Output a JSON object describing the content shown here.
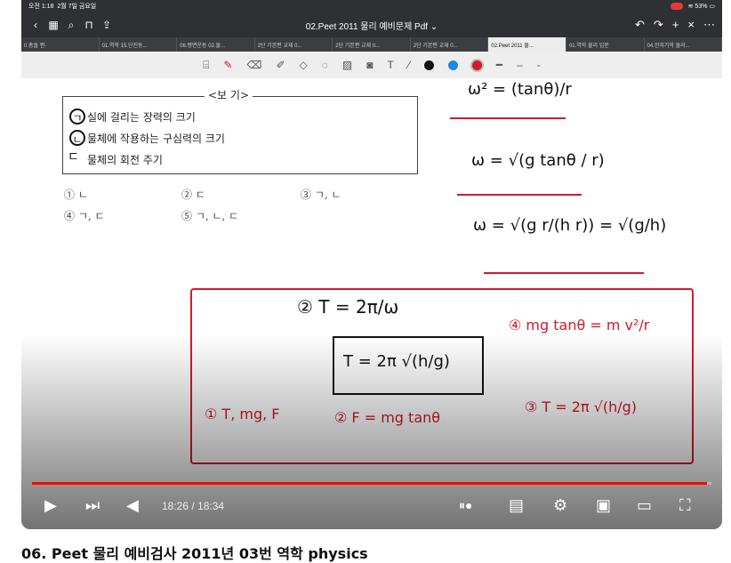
{
  "ipad_status": {
    "time": "오전 1:18",
    "date": "2월 7일 금요일",
    "battery": "53%"
  },
  "nav": {
    "doc_title": "02.Peet 2011 물리 예비문제 Pdf ⌄"
  },
  "tabs": [
    {
      "label": "0.총돌 편-"
    },
    {
      "label": "01.역학 15.단진동..."
    },
    {
      "label": "06.평면운동 02.물..."
    },
    {
      "label": "2단 기본편 교재 0..."
    },
    {
      "label": "2단 기본편 교재 0..."
    },
    {
      "label": "2단 기본편 교재 0..."
    },
    {
      "label": "02.Peet 2011 물..."
    },
    {
      "label": "01.역학 물리 입문"
    },
    {
      "label": "04.전자기학 물리..."
    }
  ],
  "colors": {
    "pen_black": "#111111",
    "pen_blue": "#1e88e5",
    "pen_red": "#d01b2a",
    "accent": "#ff0000"
  },
  "bogi": {
    "title": "<보 기>",
    "items": [
      "실에 걸리는 장력의 크기",
      "물체에 작용하는 구심력의 크기",
      "물체의 회전 주기"
    ],
    "markers": [
      "ㄱ",
      "ㄴ",
      "ㄷ"
    ]
  },
  "choices": [
    "① ㄴ",
    "② ㄷ",
    "③ ㄱ, ㄴ",
    "④ ㄱ, ㄷ",
    "⑤ ㄱ, ㄴ, ㄷ"
  ],
  "handwriting": {
    "omega_sq_top": "ω² = (tanθ)/r",
    "omega_line1": "ω = √(g tanθ / r)",
    "omega_line2": "ω = √(g r/(h r)) = √(g/h)",
    "period_label": "②  T = 2π/ω",
    "period_boxed": "T = 2π √(h/g)",
    "red_eq_top": "④ mg tanθ = m v²/r",
    "red_1": "① T, mg, F",
    "red_2": "② F = mg tanθ",
    "red_3": "③ T = 2π √(h/g)"
  },
  "player": {
    "current_time": "18:26",
    "duration": "18:34",
    "time_display": "18:26 / 18:34",
    "progress": 0.993
  },
  "video_title": "06. Peet 물리 예비검사 2011년 03번 역학 physics"
}
